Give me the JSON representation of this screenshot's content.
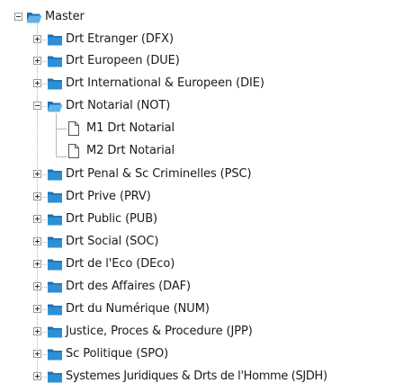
{
  "tree": {
    "root": {
      "label": "Master",
      "expanded": true
    },
    "folders": [
      {
        "label": "Drt Etranger (DFX)"
      },
      {
        "label": "Drt Europeen (DUE)"
      },
      {
        "label": "Drt International & Europeen (DIE)"
      },
      {
        "label": "Drt Notarial (NOT)"
      },
      {
        "label": "Drt Penal & Sc Criminelles (PSC)"
      },
      {
        "label": "Drt Prive (PRV)"
      },
      {
        "label": "Drt Public (PUB)"
      },
      {
        "label": "Drt Social (SOC)"
      },
      {
        "label": "Drt de l'Eco (DEco)"
      },
      {
        "label": "Drt des Affaires (DAF)"
      },
      {
        "label": "Drt du Numérique (NUM)"
      },
      {
        "label": "Justice, Proces & Procedure (JPP)"
      },
      {
        "label": "Sc Politique (SPO)"
      },
      {
        "label": "Systemes Juridiques & Drts de l'Homme (SJDH)"
      }
    ],
    "notarial_children": [
      {
        "label": "M1 Drt Notarial"
      },
      {
        "label": "M2 Drt Notarial"
      }
    ]
  },
  "colors": {
    "folder": "#2d8fd6",
    "folder_dark": "#1f6fb0",
    "folder_light": "#5fb2ea",
    "text": "#1a1a1a"
  }
}
